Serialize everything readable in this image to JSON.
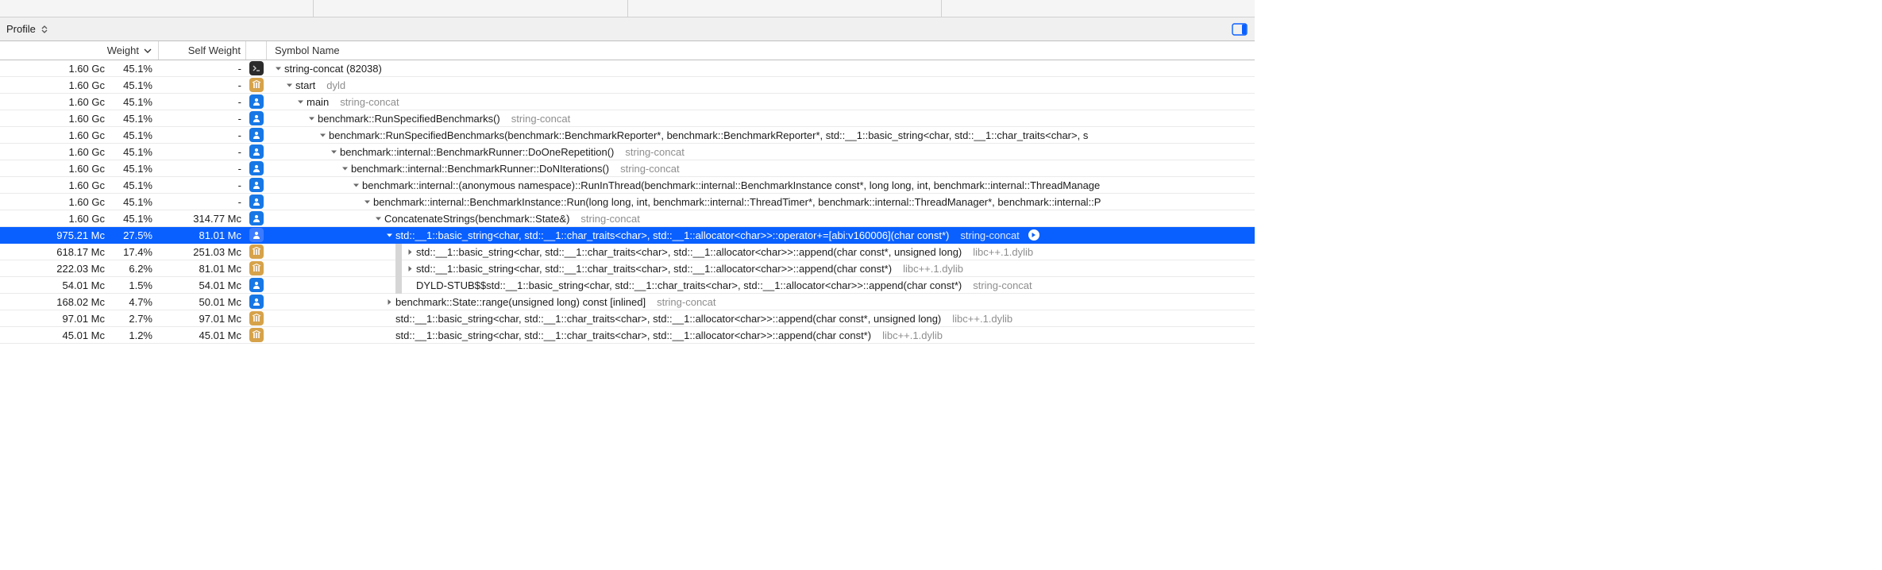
{
  "toolbar": {
    "profile_label": "Profile"
  },
  "columns": {
    "weight": "Weight",
    "self_weight": "Self Weight",
    "symbol_name": "Symbol Name"
  },
  "rows": [
    {
      "weight": "1.60 Gc",
      "pct": "45.1%",
      "self": "-",
      "icon": "terminal",
      "indent": 0,
      "disclosure": "down",
      "gutter": false,
      "name": "string-concat (82038)",
      "lib": "",
      "selected": false
    },
    {
      "weight": "1.60 Gc",
      "pct": "45.1%",
      "self": "-",
      "icon": "system",
      "indent": 1,
      "disclosure": "down",
      "gutter": false,
      "name": "start",
      "lib": "dyld",
      "selected": false
    },
    {
      "weight": "1.60 Gc",
      "pct": "45.1%",
      "self": "-",
      "icon": "user",
      "indent": 2,
      "disclosure": "down",
      "gutter": false,
      "name": "main",
      "lib": "string-concat",
      "selected": false
    },
    {
      "weight": "1.60 Gc",
      "pct": "45.1%",
      "self": "-",
      "icon": "user",
      "indent": 3,
      "disclosure": "down",
      "gutter": false,
      "name": "benchmark::RunSpecifiedBenchmarks()",
      "lib": "string-concat",
      "selected": false
    },
    {
      "weight": "1.60 Gc",
      "pct": "45.1%",
      "self": "-",
      "icon": "user",
      "indent": 4,
      "disclosure": "down",
      "gutter": false,
      "name": "benchmark::RunSpecifiedBenchmarks(benchmark::BenchmarkReporter*, benchmark::BenchmarkReporter*, std::__1::basic_string<char, std::__1::char_traits<char>, s",
      "lib": "",
      "selected": false
    },
    {
      "weight": "1.60 Gc",
      "pct": "45.1%",
      "self": "-",
      "icon": "user",
      "indent": 5,
      "disclosure": "down",
      "gutter": false,
      "name": "benchmark::internal::BenchmarkRunner::DoOneRepetition()",
      "lib": "string-concat",
      "selected": false
    },
    {
      "weight": "1.60 Gc",
      "pct": "45.1%",
      "self": "-",
      "icon": "user",
      "indent": 6,
      "disclosure": "down",
      "gutter": false,
      "name": "benchmark::internal::BenchmarkRunner::DoNIterations()",
      "lib": "string-concat",
      "selected": false
    },
    {
      "weight": "1.60 Gc",
      "pct": "45.1%",
      "self": "-",
      "icon": "user",
      "indent": 7,
      "disclosure": "down",
      "gutter": false,
      "name": "benchmark::internal::(anonymous namespace)::RunInThread(benchmark::internal::BenchmarkInstance const*, long long, int, benchmark::internal::ThreadManage",
      "lib": "",
      "selected": false
    },
    {
      "weight": "1.60 Gc",
      "pct": "45.1%",
      "self": "-",
      "icon": "user",
      "indent": 8,
      "disclosure": "down",
      "gutter": false,
      "name": "benchmark::internal::BenchmarkInstance::Run(long long, int, benchmark::internal::ThreadTimer*, benchmark::internal::ThreadManager*, benchmark::internal::P",
      "lib": "",
      "selected": false
    },
    {
      "weight": "1.60 Gc",
      "pct": "45.1%",
      "self": "314.77 Mc",
      "icon": "user",
      "indent": 9,
      "disclosure": "down",
      "gutter": false,
      "name": "ConcatenateStrings(benchmark::State&)",
      "lib": "string-concat",
      "selected": false
    },
    {
      "weight": "975.21 Mc",
      "pct": "27.5%",
      "self": "81.01 Mc",
      "icon": "user",
      "indent": 10,
      "disclosure": "down",
      "gutter": false,
      "name": "std::__1::basic_string<char, std::__1::char_traits<char>, std::__1::allocator<char>>::operator+=[abi:v160006](char const*)",
      "lib": "string-concat",
      "selected": true,
      "focus": true
    },
    {
      "weight": "618.17 Mc",
      "pct": "17.4%",
      "self": "251.03 Mc",
      "icon": "system",
      "indent": 11,
      "disclosure": "right",
      "gutter": true,
      "name": "std::__1::basic_string<char, std::__1::char_traits<char>, std::__1::allocator<char>>::append(char const*, unsigned long)",
      "lib": "libc++.1.dylib",
      "selected": false
    },
    {
      "weight": "222.03 Mc",
      "pct": "6.2%",
      "self": "81.01 Mc",
      "icon": "system",
      "indent": 11,
      "disclosure": "right",
      "gutter": true,
      "name": "std::__1::basic_string<char, std::__1::char_traits<char>, std::__1::allocator<char>>::append(char const*)",
      "lib": "libc++.1.dylib",
      "selected": false
    },
    {
      "weight": "54.01 Mc",
      "pct": "1.5%",
      "self": "54.01 Mc",
      "icon": "user",
      "indent": 11,
      "disclosure": "none",
      "gutter": true,
      "name": "DYLD-STUB$$std::__1::basic_string<char, std::__1::char_traits<char>, std::__1::allocator<char>>::append(char const*)",
      "lib": "string-concat",
      "selected": false
    },
    {
      "weight": "168.02 Mc",
      "pct": "4.7%",
      "self": "50.01 Mc",
      "icon": "user",
      "indent": 10,
      "disclosure": "right",
      "gutter": false,
      "name": "benchmark::State::range(unsigned long) const [inlined]",
      "lib": "string-concat",
      "selected": false
    },
    {
      "weight": "97.01 Mc",
      "pct": "2.7%",
      "self": "97.01 Mc",
      "icon": "system",
      "indent": 10,
      "disclosure": "none",
      "gutter": false,
      "name": "std::__1::basic_string<char, std::__1::char_traits<char>, std::__1::allocator<char>>::append(char const*, unsigned long)",
      "lib": "libc++.1.dylib",
      "selected": false
    },
    {
      "weight": "45.01 Mc",
      "pct": "1.2%",
      "self": "45.01 Mc",
      "icon": "system",
      "indent": 10,
      "disclosure": "none",
      "gutter": false,
      "name": "std::__1::basic_string<char, std::__1::char_traits<char>, std::__1::allocator<char>>::append(char const*)",
      "lib": "libc++.1.dylib",
      "selected": false
    }
  ]
}
